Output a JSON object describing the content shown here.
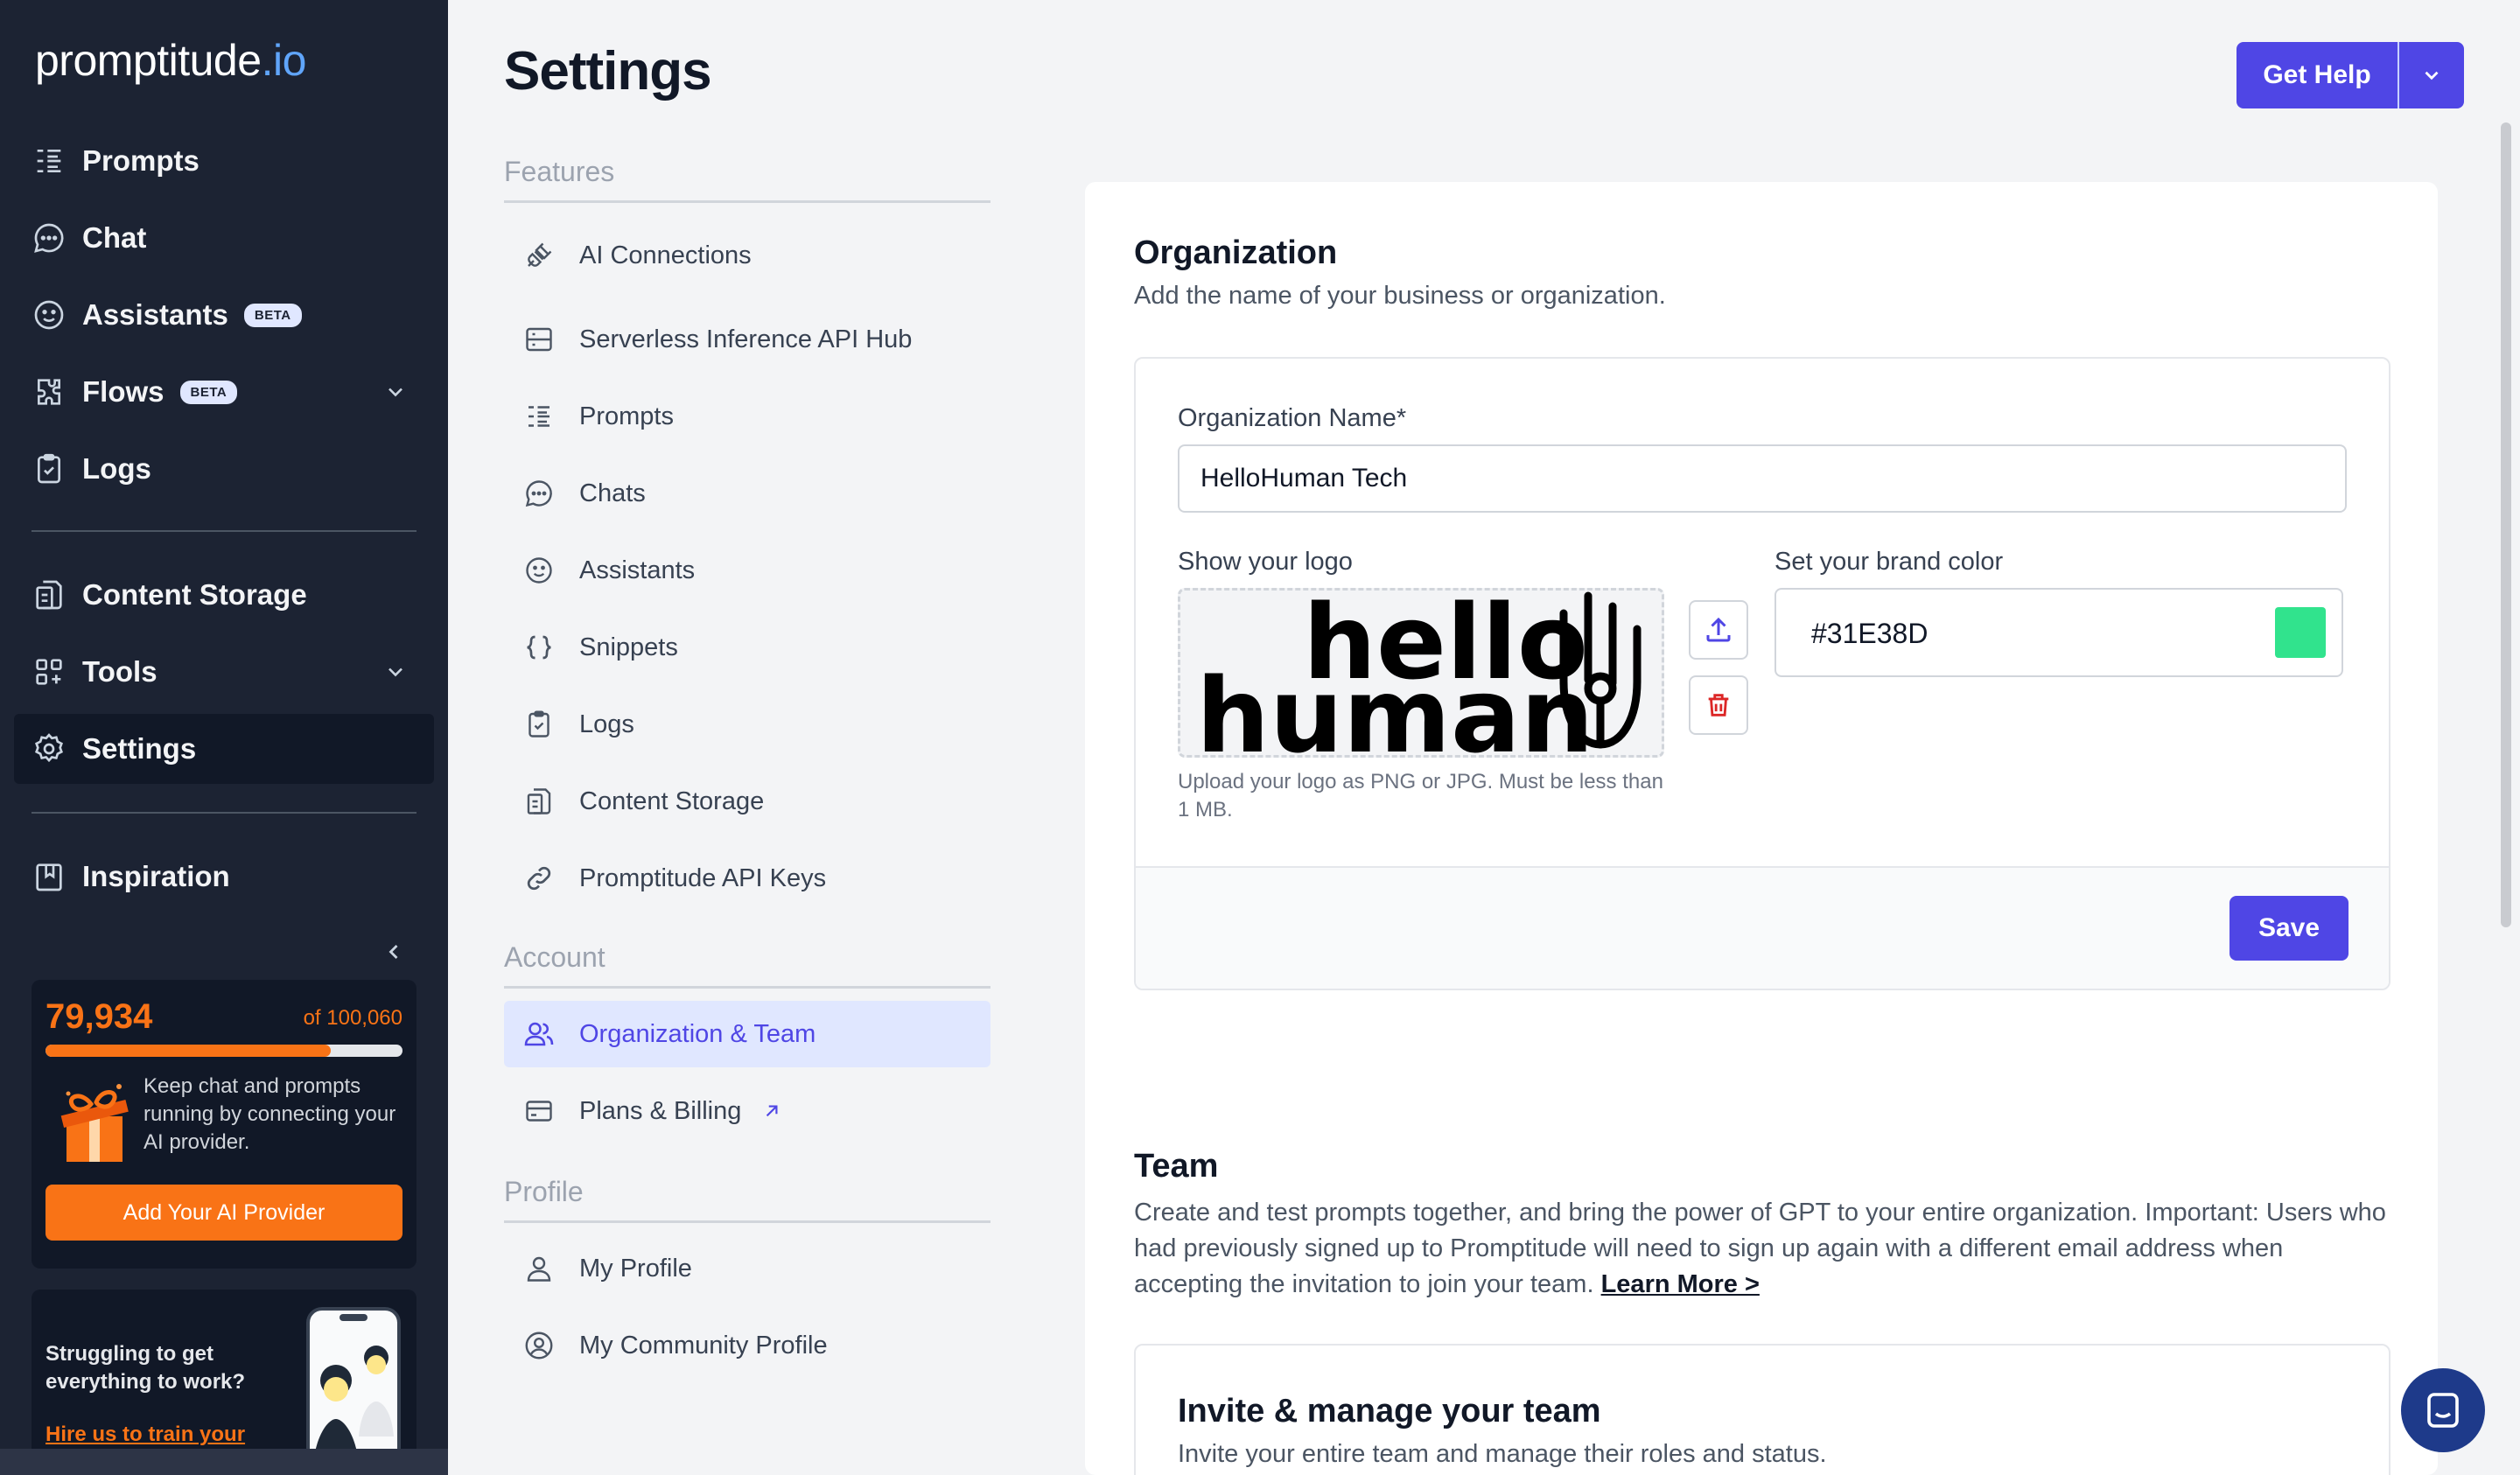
{
  "brand": {
    "name_part1": "prompt",
    "name_part2": "itude",
    "name_part3": ".io"
  },
  "sidebar": {
    "items": [
      {
        "label": "Prompts",
        "icon": "list-icon"
      },
      {
        "label": "Chat",
        "icon": "chat-icon"
      },
      {
        "label": "Assistants",
        "icon": "smiley-icon",
        "badge": "BETA"
      },
      {
        "label": "Flows",
        "icon": "puzzle-icon",
        "badge": "BETA"
      },
      {
        "label": "Logs",
        "icon": "clipboard-icon"
      },
      {
        "label": "Content Storage",
        "icon": "storage-icon"
      },
      {
        "label": "Tools",
        "icon": "grid-icon"
      },
      {
        "label": "Settings",
        "icon": "gear-icon"
      },
      {
        "label": "Inspiration",
        "icon": "book-icon"
      }
    ],
    "usage": {
      "count": "79,934",
      "total": "of 100,060",
      "fraction": 0.7989,
      "message": "Keep chat and prompts running by connecting your AI provider.",
      "button": "Add Your AI Provider"
    },
    "promo": {
      "text": "Struggling to get everything to work?",
      "link": "Hire us to train your team and set up"
    }
  },
  "settings_page": {
    "title": "Settings",
    "features_heading": "Features",
    "features": [
      "AI Connections",
      "Serverless Inference API Hub",
      "Prompts",
      "Chats",
      "Assistants",
      "Snippets",
      "Logs",
      "Content Storage",
      "Promptitude API Keys"
    ],
    "account_heading": "Account",
    "account": [
      "Organization & Team",
      "Plans & Billing"
    ],
    "profile_heading": "Profile",
    "profile": [
      "My Profile",
      "My Community Profile"
    ]
  },
  "header": {
    "help_label": "Get Help"
  },
  "organization": {
    "title": "Organization",
    "subtitle": "Add the name of your business or organization.",
    "name_label": "Organization Name*",
    "name_value": "HelloHuman Tech",
    "logo_label": "Show your logo",
    "logo_text_line1": "hello",
    "logo_text_line2": "human",
    "logo_hint": "Upload your logo as PNG or JPG. Must be less than 1 MB.",
    "brand_label": "Set your brand color",
    "brand_color": "#31E38D",
    "save_label": "Save"
  },
  "team": {
    "title": "Team",
    "description": "Create and test prompts together, and bring the power of GPT to your entire organization. Important: Users who had previously signed up to Promptitude will need to sign up again with a different email address when accepting the invitation to join your team.",
    "learn_more": "Learn More >",
    "invite_title": "Invite & manage your team",
    "invite_subtitle": "Invite your entire team and manage their roles and status."
  },
  "colors": {
    "accent": "#4F46E5",
    "sidebar_bg": "#1C2333",
    "orange": "#F97316"
  }
}
